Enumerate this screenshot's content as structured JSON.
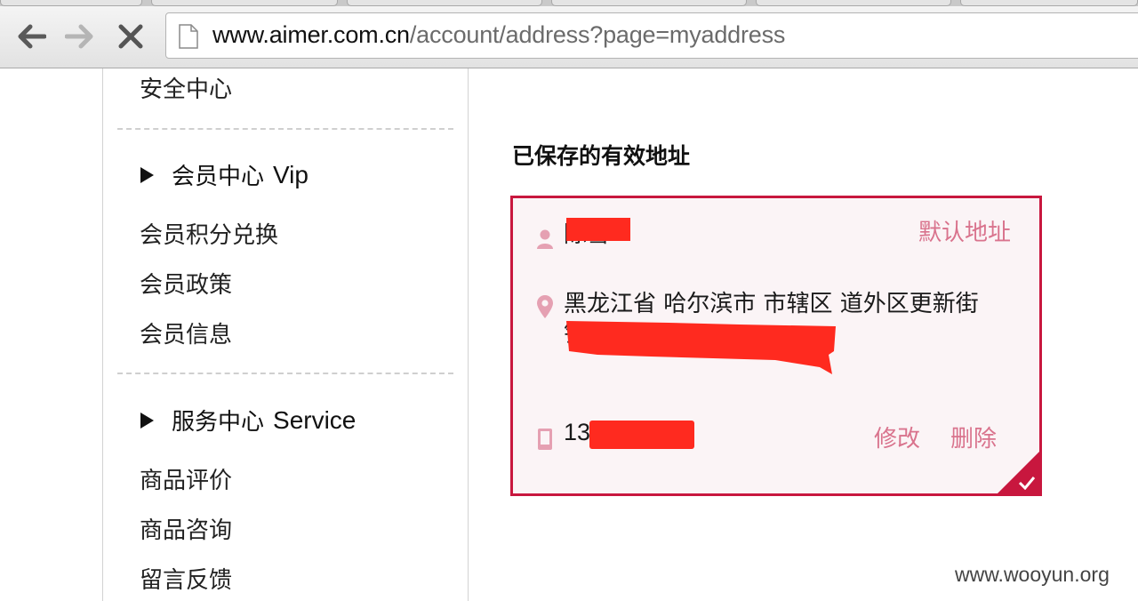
{
  "browser": {
    "url_host": "www.aimer.com.cn",
    "url_path": "/account/address?page=myaddress"
  },
  "sidebar": {
    "security": "安全中心",
    "member_section": {
      "title": "会员中心",
      "title_en": "Vip"
    },
    "member_items": [
      "会员积分兑换",
      "会员政策",
      "会员信息"
    ],
    "service_section": {
      "title": "服务中心",
      "title_en": "Service"
    },
    "service_items": [
      "商品评价",
      "商品咨询",
      "留言反馈"
    ]
  },
  "main": {
    "title": "已保存的有效地址",
    "card": {
      "name": "陈雪",
      "default_label": "默认地址",
      "address_line1": "黑龙江省 哈尔滨市 市辖区 道外区更新街",
      "address_line2": "镇江",
      "phone": "13           19",
      "edit": "修改",
      "delete": "删除",
      "accent_color": "#c8173e",
      "link_color": "#d9738d"
    }
  },
  "watermark": "www.wooyun.org"
}
